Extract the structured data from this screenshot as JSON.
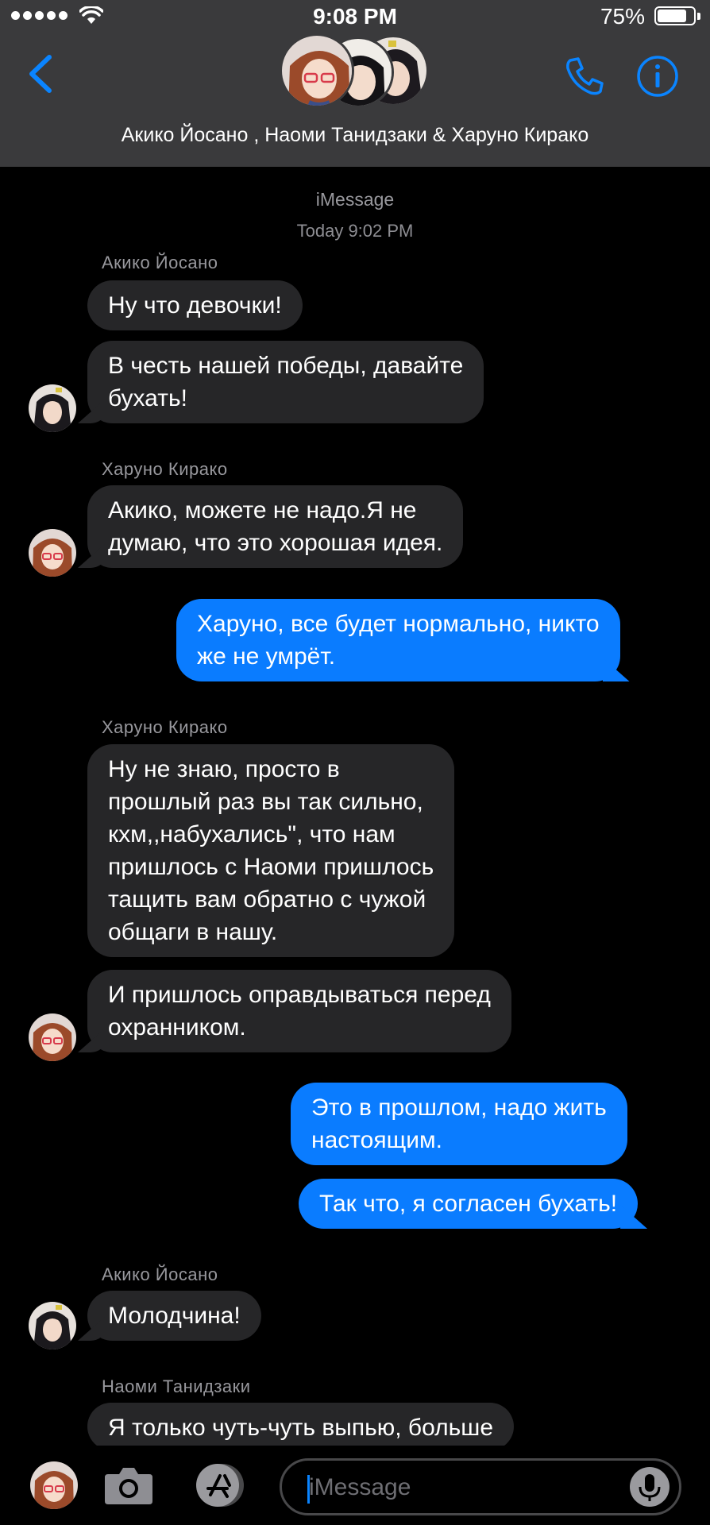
{
  "status_bar": {
    "time": "9:08 PM",
    "battery_percent": "75%",
    "battery_level": 0.75,
    "signal_bars": 5
  },
  "header": {
    "group_title": "Акико Йосано , Наоми Танидзаки & Харуно Кирако",
    "icons": [
      "chevron-left-icon",
      "phone-icon",
      "info-icon"
    ],
    "accent_color": "#0a84ff"
  },
  "conversation": {
    "service": "iMessage",
    "timestamp": "Today 9:02 PM",
    "senders": {
      "s1": "Акико Йосано",
      "s2": "Харуно Кирако",
      "s3": "Харуно Кирако",
      "s4": "Акико Йосано",
      "s5": "Наоми Танидзаки"
    },
    "messages": [
      "Ну что девочки!",
      "В честь нашей победы, давайте\nбухать!",
      "Акико, можете не надо.Я не\nдумаю, что это хорошая идея.",
      "Харуно, все будет нормально, никто\nже не умрёт.",
      "Ну не знаю, просто в\nпрошлый раз вы так сильно,\nкхм,,набухались\", что нам\nпришлось с Наоми пришлось\nтащить вам обратно с чужой\nобщаги в нашу.",
      "И пришлось оправдываться перед\nохранником.",
      "Это в прошлом, надо жить\nнастоящим.",
      "Так что, я согласен бухать!",
      "Молодчина!",
      "Я только чуть-чуть выпью, больше"
    ],
    "incoming_color": "#262628",
    "outgoing_color": "#0a7cff"
  },
  "input_bar": {
    "placeholder": "iMessage",
    "icons": [
      "camera-icon",
      "app-store-icon",
      "microphone-icon"
    ]
  }
}
